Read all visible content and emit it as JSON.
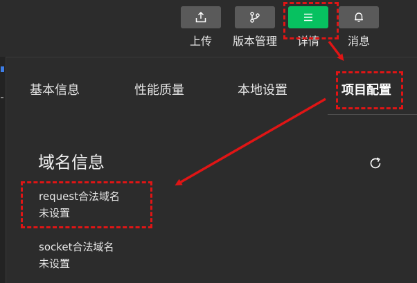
{
  "toolbar": {
    "upload_label": "上传",
    "version_label": "版本管理",
    "details_label": "详情",
    "messages_label": "消息"
  },
  "tabs": {
    "basic_info": "基本信息",
    "performance": "性能质量",
    "local_settings": "本地设置",
    "project_config": "项目配置"
  },
  "domain_section": {
    "title": "域名信息",
    "request_label": "request合法域名",
    "request_value": "未设置",
    "socket_label": "socket合法域名",
    "socket_value": "未设置"
  },
  "colors": {
    "background": "#2c2c2c",
    "button": "#5a5a5a",
    "active_button": "#07c160",
    "annotation": "#e01515",
    "text": "#e8e8e8"
  },
  "icons": {
    "upload": "upload-icon",
    "version": "branch-icon",
    "details": "menu-icon",
    "messages": "bell-icon",
    "refresh": "refresh-icon"
  }
}
